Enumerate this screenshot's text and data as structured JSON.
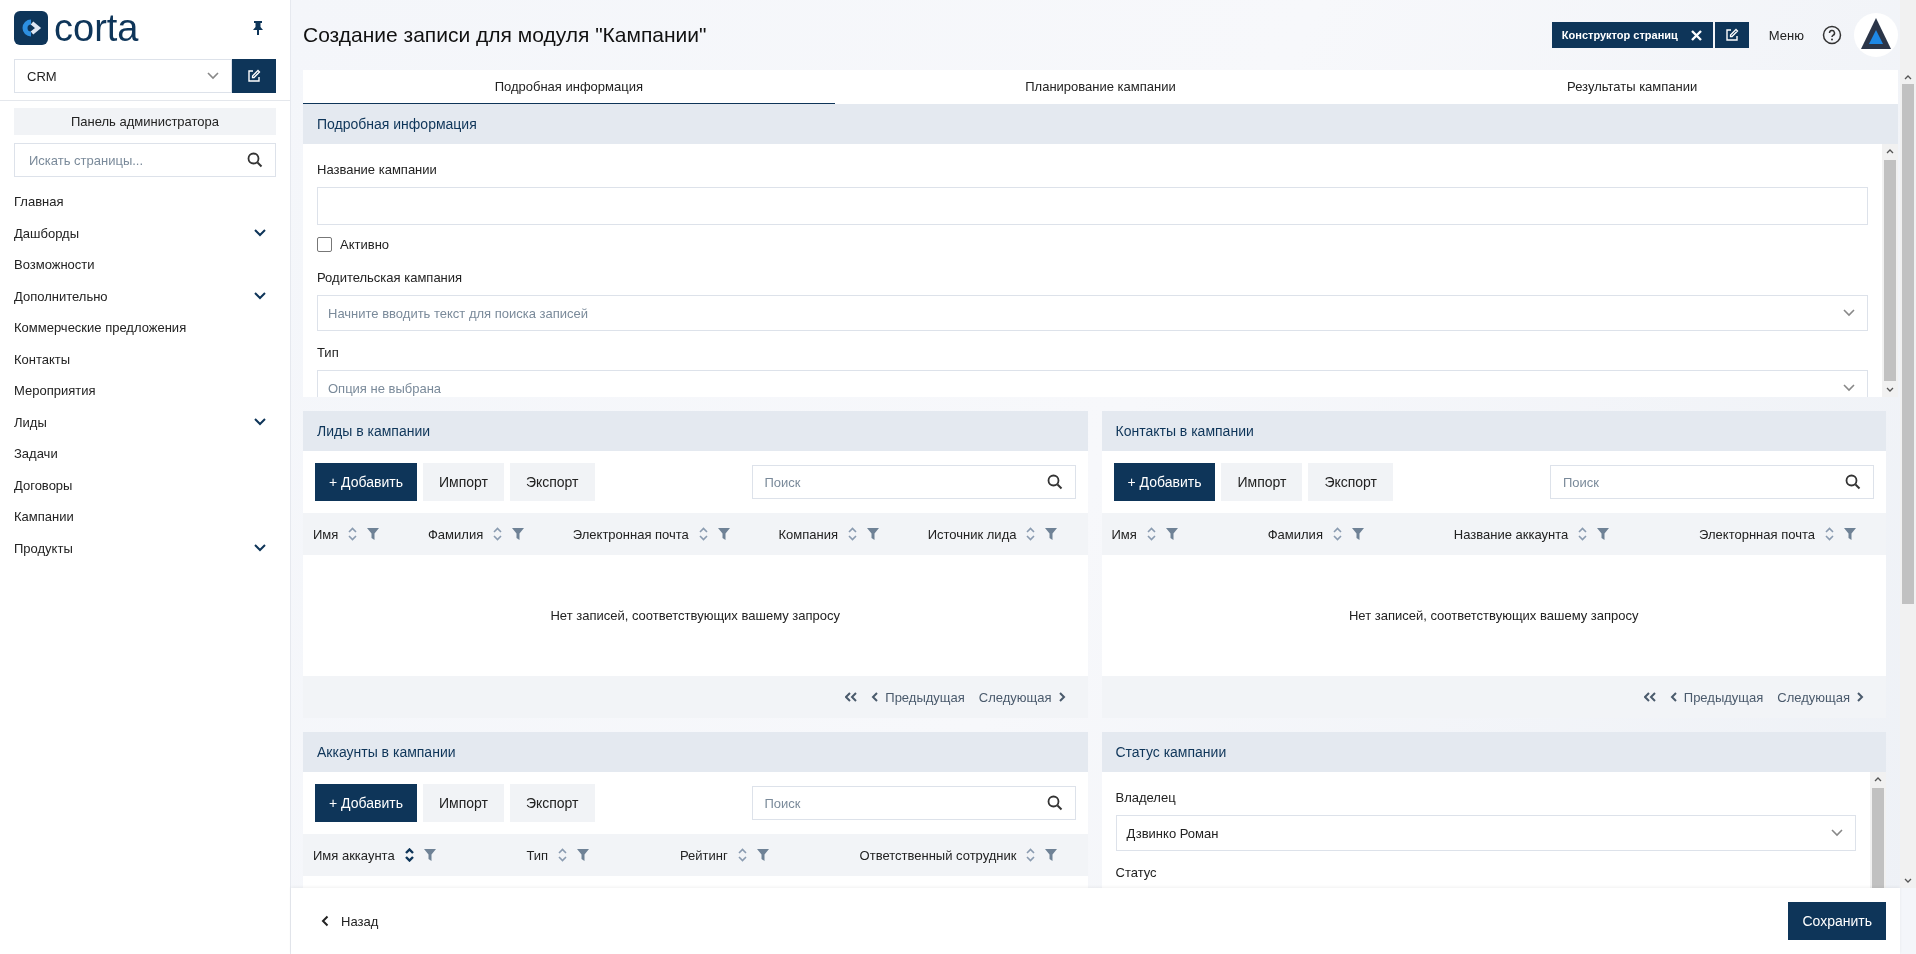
{
  "sidebar": {
    "logo_text": "corta",
    "module_select": {
      "value": "CRM"
    },
    "admin_button": "Панель администратора",
    "search": {
      "placeholder": "Искать страницы..."
    },
    "items": [
      {
        "label": "Главная",
        "expandable": false
      },
      {
        "label": "Дашборды",
        "expandable": true
      },
      {
        "label": "Возможности",
        "expandable": false
      },
      {
        "label": "Дополнительно",
        "expandable": true
      },
      {
        "label": "Коммерческие предложения",
        "expandable": false
      },
      {
        "label": "Контакты",
        "expandable": false
      },
      {
        "label": "Мероприятия",
        "expandable": false
      },
      {
        "label": "Лиды",
        "expandable": true
      },
      {
        "label": "Задачи",
        "expandable": false
      },
      {
        "label": "Договоры",
        "expandable": false
      },
      {
        "label": "Кампании",
        "expandable": false
      },
      {
        "label": "Продукты",
        "expandable": true
      }
    ]
  },
  "header": {
    "title": "Создание записи для модуля \"Кампании\"",
    "builder_button": "Конструктор страниц",
    "menu_label": "Меню"
  },
  "tabs": [
    {
      "label": "Подробная информация",
      "selected": true
    },
    {
      "label": "Планирование кампании",
      "selected": false
    },
    {
      "label": "Результаты кампании",
      "selected": false
    }
  ],
  "details": {
    "title": "Подробная информация",
    "fields": [
      {
        "kind": "text",
        "label": "Название кампании"
      },
      {
        "kind": "checkbox",
        "label": "Активно",
        "checked": false
      },
      {
        "kind": "select",
        "label": "Родительская кампания",
        "placeholder": "Начните вводить текст для поиска записей"
      },
      {
        "kind": "select",
        "label": "Тип",
        "placeholder": "Опция не выбрана"
      }
    ]
  },
  "panels": [
    {
      "kind": "table",
      "title": "Лиды в кампании",
      "add_button": "+ Добавить",
      "import_button": "Импорт",
      "export_button": "Экспорт",
      "search_placeholder": "Поиск",
      "columns": [
        {
          "label": "Имя",
          "sorted": false
        },
        {
          "label": "Фамилия",
          "sorted": false
        },
        {
          "label": "Электронная почта",
          "sorted": false
        },
        {
          "label": "Компания",
          "sorted": false
        },
        {
          "label": "Источник лида",
          "sorted": false
        }
      ],
      "empty_message": "Нет записей, соответствующих вашему запросу",
      "prev_label": "Предыдущая",
      "next_label": "Следующая"
    },
    {
      "kind": "table",
      "title": "Контакты в кампании",
      "add_button": "+ Добавить",
      "import_button": "Импорт",
      "export_button": "Экспорт",
      "search_placeholder": "Поиск",
      "columns": [
        {
          "label": "Имя",
          "sorted": false
        },
        {
          "label": "Фамилия",
          "sorted": false
        },
        {
          "label": "Название аккаунта",
          "sorted": false
        },
        {
          "label": "Электорнная почта",
          "sorted": false
        }
      ],
      "empty_message": "Нет записей, соответствующих вашему запросу",
      "prev_label": "Предыдущая",
      "next_label": "Следующая"
    },
    {
      "kind": "table",
      "title": "Аккаунты в кампании",
      "add_button": "+ Добавить",
      "import_button": "Импорт",
      "export_button": "Экспорт",
      "search_placeholder": "Поиск",
      "columns": [
        {
          "label": "Имя аккаунта",
          "sorted": true
        },
        {
          "label": "Тип",
          "sorted": false
        },
        {
          "label": "Рейтинг",
          "sorted": false
        },
        {
          "label": "Ответственный сотрудник",
          "sorted": false
        }
      ]
    },
    {
      "kind": "form",
      "title": "Статус кампании",
      "fields": [
        {
          "kind": "select",
          "label": "Владелец",
          "value": "Дзвинко Роман"
        },
        {
          "kind": "label",
          "label": "Статус"
        }
      ]
    }
  ],
  "footer": {
    "back_label": "Назад",
    "save_button": "Сохранить"
  }
}
